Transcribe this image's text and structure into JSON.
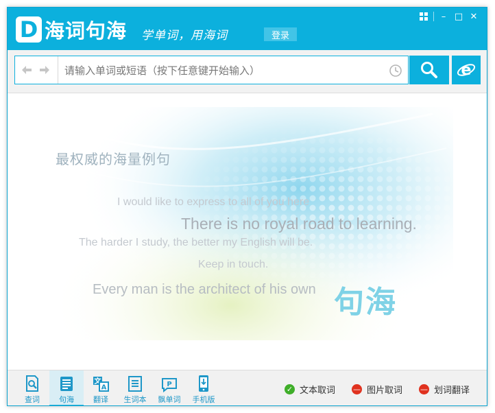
{
  "app": {
    "logo_letter": "D",
    "logo_name": "海词句海",
    "slogan": "学单词，用海词",
    "login_label": "登录",
    "accent_color": "#0cb0dd"
  },
  "window_controls": {
    "menu_icon": "grid-menu-icon",
    "minimize": "–",
    "maximize": "□",
    "close": "✕"
  },
  "search": {
    "placeholder": "请输入单词或短语（按下任意键开始输入）",
    "back_icon": "arrow-left-icon",
    "forward_icon": "arrow-right-icon",
    "history_icon": "clock-icon",
    "search_icon": "magnifier-icon",
    "browser_icon": "ie-icon"
  },
  "banner": {
    "tagline": "最权威的海量例句",
    "examples": [
      "I would like to express to all of you here",
      "There is no royal road to learning.",
      "The harder I study, the better my English will be.",
      "Keep in touch.",
      "Every man is the architect of his own"
    ],
    "brandmark": "句海"
  },
  "toolbar": {
    "active_index": 1,
    "items": [
      {
        "label": "查词",
        "icon": "search-dict-icon"
      },
      {
        "label": "句海",
        "icon": "sentence-sea-icon"
      },
      {
        "label": "翻译",
        "icon": "translate-icon"
      },
      {
        "label": "生词本",
        "icon": "notebook-icon"
      },
      {
        "label": "飘单词",
        "icon": "floating-word-icon"
      },
      {
        "label": "手机版",
        "icon": "mobile-icon"
      }
    ]
  },
  "capture": {
    "text_capture": {
      "label": "文本取词",
      "state": "on",
      "color": "#3fae29"
    },
    "image_capture": {
      "label": "图片取词",
      "state": "off",
      "color": "#e0321f"
    },
    "selection_translate": {
      "label": "划词翻译",
      "state": "off",
      "color": "#e0321f"
    }
  }
}
